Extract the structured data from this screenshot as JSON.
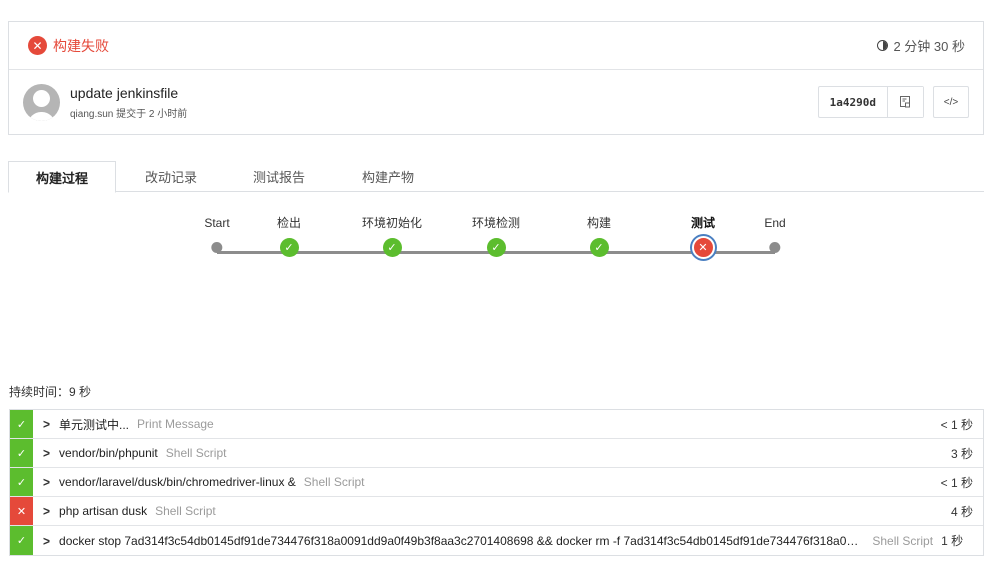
{
  "build": {
    "status_label": "构建失败",
    "status_icon": "close-circle-icon",
    "duration": "2 分钟 30 秒",
    "colors": {
      "failure": "#e5493a",
      "success": "#5cbd2e",
      "selected_ring": "#4a7fc1"
    }
  },
  "commit": {
    "title": "update jenkinsfile",
    "meta": "qiang.sun 提交于 2 小时前",
    "sha": "1a4290d",
    "copy_icon": "▤",
    "code_icon": "</>"
  },
  "tabs": [
    {
      "label": "构建过程",
      "active": true
    },
    {
      "label": "改动记录",
      "active": false
    },
    {
      "label": "测试报告",
      "active": false
    },
    {
      "label": "构建产物",
      "active": false
    }
  ],
  "pipeline": {
    "stages": [
      {
        "label": "Start",
        "status": "endpoint"
      },
      {
        "label": "检出",
        "status": "success"
      },
      {
        "label": "环境初始化",
        "status": "success"
      },
      {
        "label": "环境检测",
        "status": "success"
      },
      {
        "label": "构建",
        "status": "success"
      },
      {
        "label": "测试",
        "status": "failed",
        "selected": true
      },
      {
        "label": "End",
        "status": "endpoint"
      }
    ]
  },
  "stage_detail": {
    "duration_label": "持续时间：9 秒",
    "steps": [
      {
        "status": "success",
        "name": "单元测试中...",
        "type": "Print Message",
        "time": "< 1 秒"
      },
      {
        "status": "success",
        "name": "vendor/bin/phpunit",
        "type": "Shell Script",
        "time": "3 秒"
      },
      {
        "status": "success",
        "name": "vendor/laravel/dusk/bin/chromedriver-linux &",
        "type": "Shell Script",
        "time": "< 1 秒"
      },
      {
        "status": "failed",
        "name": "php artisan dusk",
        "type": "Shell Script",
        "time": "4 秒"
      },
      {
        "status": "success",
        "name": "docker stop 7ad314f3c54db0145df91de734476f318a0091dd9a0f49b3f8aa3c2701408698 && docker rm -f 7ad314f3c54db0145df91de734476f318a0…",
        "type": "Shell Script",
        "time": "1 秒",
        "type_right": true
      }
    ],
    "icons": {
      "success": "✓",
      "failed": "✕",
      "expand": "›"
    }
  }
}
